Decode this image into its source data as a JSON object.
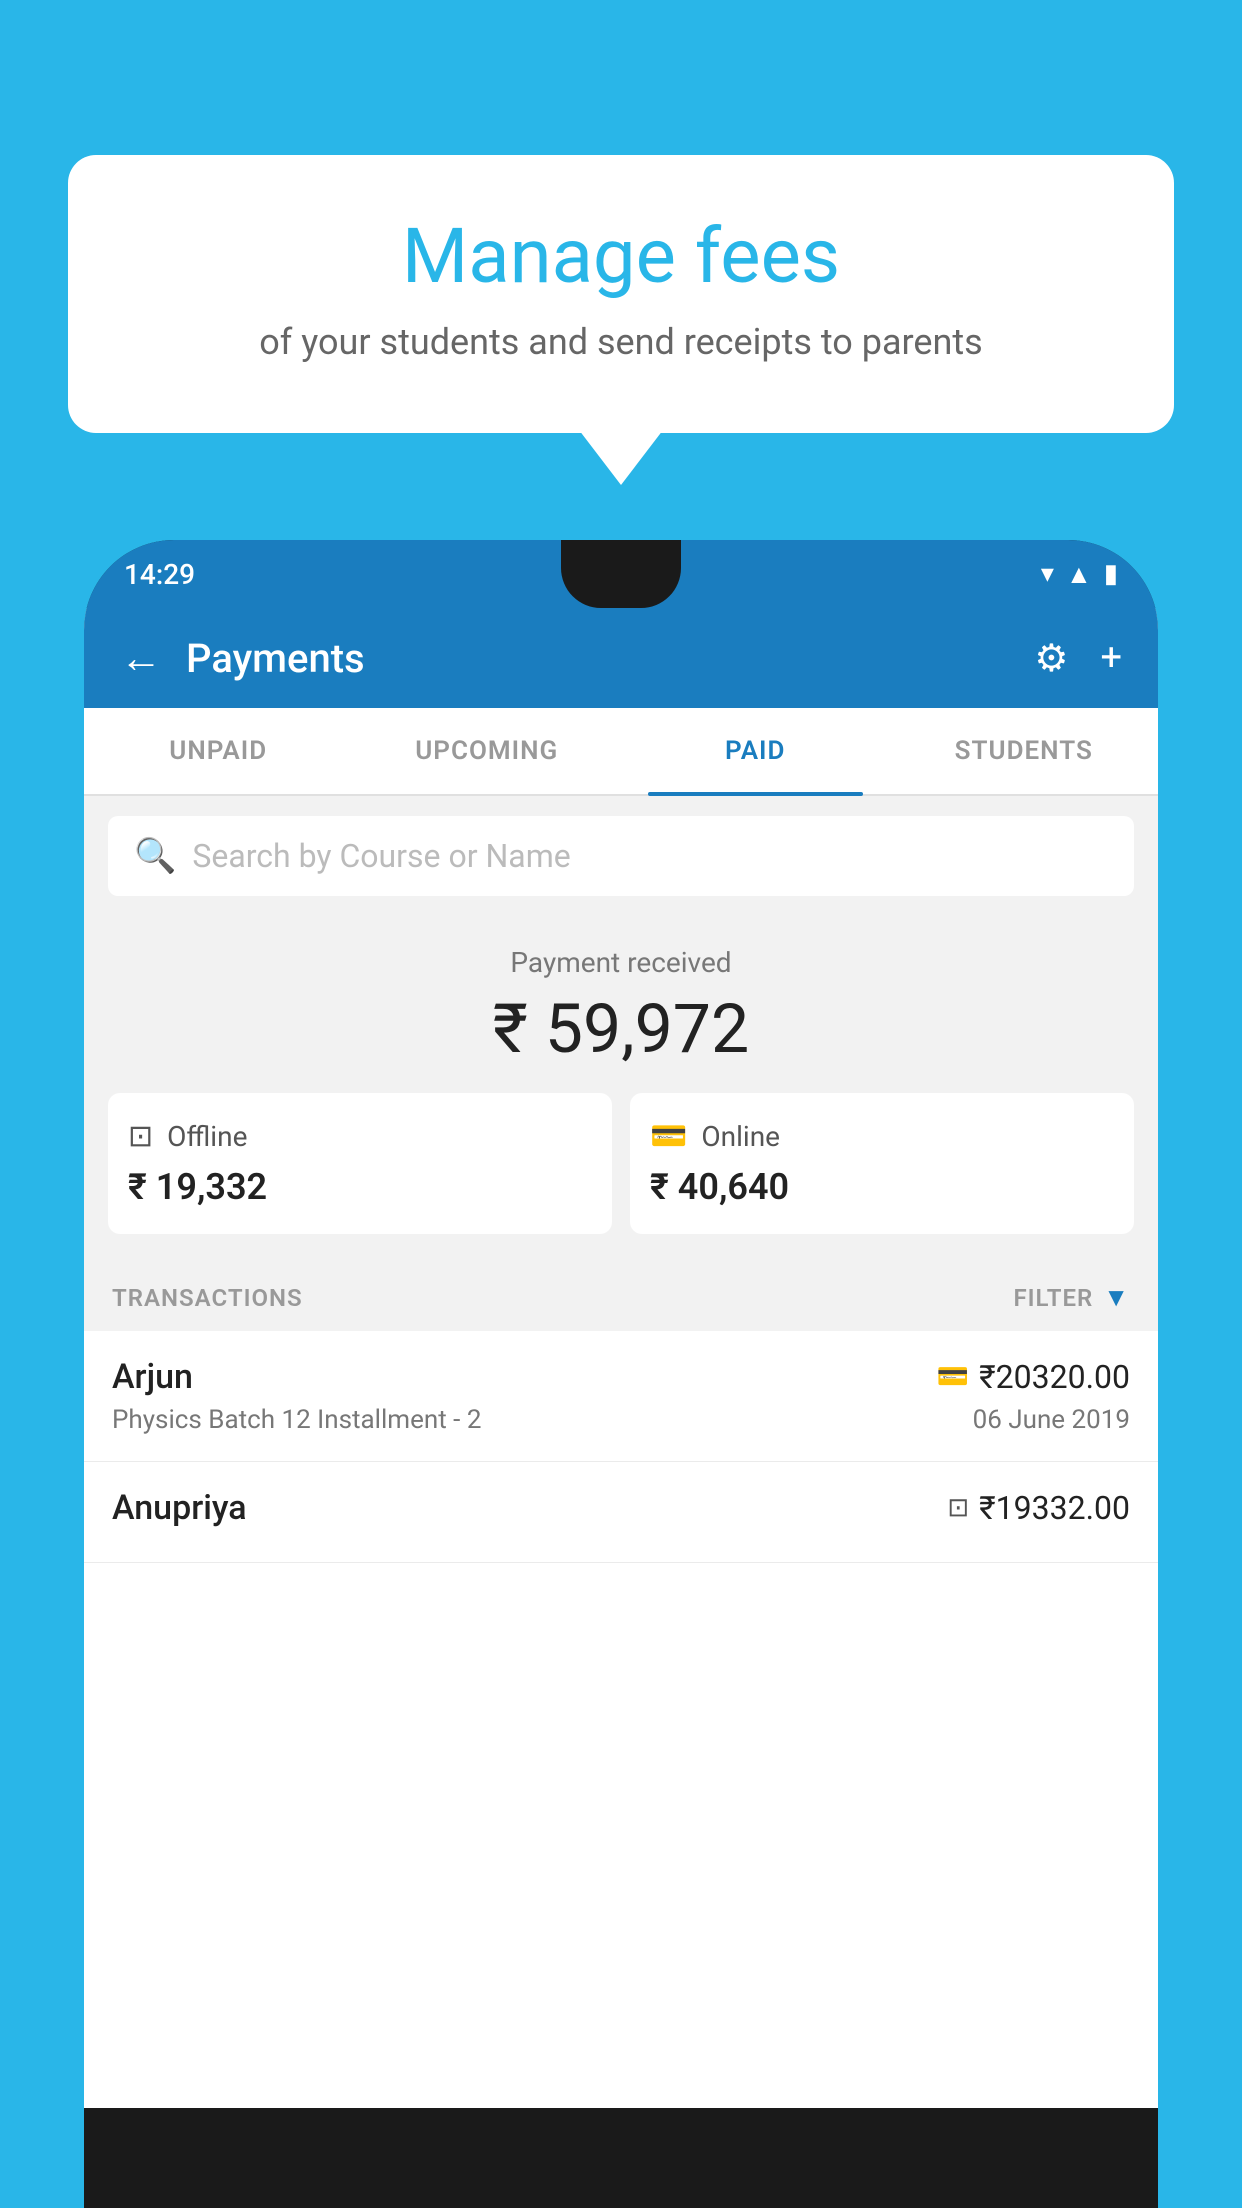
{
  "background": {
    "color": "#29b6e8"
  },
  "bubble": {
    "title": "Manage fees",
    "subtitle": "of your students and send receipts to parents"
  },
  "status_bar": {
    "time": "14:29",
    "icons": [
      "wifi",
      "signal",
      "battery"
    ]
  },
  "header": {
    "title": "Payments",
    "back_label": "←",
    "gear_label": "⚙",
    "plus_label": "+"
  },
  "tabs": [
    {
      "label": "UNPAID",
      "active": false
    },
    {
      "label": "UPCOMING",
      "active": false
    },
    {
      "label": "PAID",
      "active": true
    },
    {
      "label": "STUDENTS",
      "active": false
    }
  ],
  "search": {
    "placeholder": "Search by Course or Name"
  },
  "payment": {
    "label": "Payment received",
    "amount": "₹ 59,972",
    "offline": {
      "icon": "₹",
      "label": "Offline",
      "amount": "₹ 19,332"
    },
    "online": {
      "icon": "💳",
      "label": "Online",
      "amount": "₹ 40,640"
    }
  },
  "transactions": {
    "header_label": "TRANSACTIONS",
    "filter_label": "FILTER",
    "items": [
      {
        "name": "Arjun",
        "course": "Physics Batch 12 Installment - 2",
        "amount": "₹20320.00",
        "date": "06 June 2019",
        "payment_type": "card"
      },
      {
        "name": "Anupriya",
        "course": "",
        "amount": "₹19332.00",
        "date": "",
        "payment_type": "offline"
      }
    ]
  }
}
